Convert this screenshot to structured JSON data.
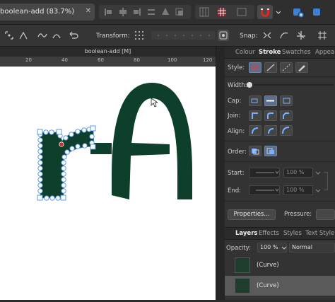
{
  "document": {
    "tab_title": "boolean-add (83.7%)",
    "tab_close": "✕",
    "canvas_title": "boolean-add [M]"
  },
  "context_toolbar": {
    "transform_label": "Transform:",
    "snap_label": "Snap:"
  },
  "ruler": {
    "labels": [
      "20",
      "40",
      "60",
      "80",
      "100",
      "120"
    ]
  },
  "panel": {
    "tabs": [
      "Colour",
      "Stroke",
      "Swatches",
      "Appea"
    ],
    "active_tab": "Stroke",
    "style_label": "Style:",
    "width_label": "Width:",
    "cap_label": "Cap:",
    "join_label": "Join:",
    "align_label": "Align:",
    "order_label": "Order:",
    "start_label": "Start:",
    "end_label": "End:",
    "start_percent": "100 %",
    "end_percent": "100 %",
    "properties_button": "Properties...",
    "pressure_label": "Pressure:"
  },
  "layers": {
    "tabs": [
      "Layers",
      "Effects",
      "Styles",
      "Text Style"
    ],
    "active_tab": "Layers",
    "opacity_label": "Opacity:",
    "opacity_value": "100 %",
    "blend_mode": "Normal",
    "items": [
      {
        "name": "(Curve)"
      },
      {
        "name": "(Curve)"
      }
    ]
  },
  "colors": {
    "shape_fill": "#0e3f2a",
    "accent": "#3b82d6"
  }
}
